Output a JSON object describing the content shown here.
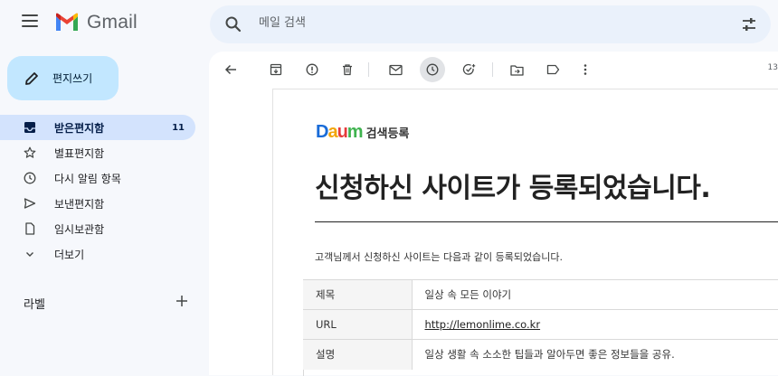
{
  "app": {
    "name": "Gmail"
  },
  "search": {
    "placeholder": "메일 검색"
  },
  "compose": {
    "label": "편지쓰기"
  },
  "nav": {
    "items": [
      {
        "label": "받은편지함",
        "count": "11",
        "icon": "inbox-icon"
      },
      {
        "label": "별표편지함",
        "icon": "star-icon"
      },
      {
        "label": "다시 알림 항목",
        "icon": "clock-icon"
      },
      {
        "label": "보낸편지함",
        "icon": "send-icon"
      },
      {
        "label": "임시보관함",
        "icon": "draft-icon"
      },
      {
        "label": "더보기",
        "icon": "chevron-down-icon"
      }
    ],
    "labels_heading": "라벨"
  },
  "toolbar": {
    "count": "13"
  },
  "email": {
    "brand": "검색등록",
    "headline": "신청하신 사이트가 등록되었습니다.",
    "intro": "고객님께서 신청하신 사이트는 다음과 같이 등록되었습니다.",
    "rows": [
      {
        "key": "제목",
        "value": "일상 속 모든 이야기"
      },
      {
        "key": "URL",
        "value": "http://lemonlime.co.kr"
      },
      {
        "key": "설명",
        "value": "일상 생활 속 소소한 팁들과 알아두면 좋은 정보들을 공유."
      }
    ]
  },
  "colors": {
    "accent": "#c2e7ff",
    "active_nav": "#d3e3fd",
    "background": "#f6f8fc"
  }
}
